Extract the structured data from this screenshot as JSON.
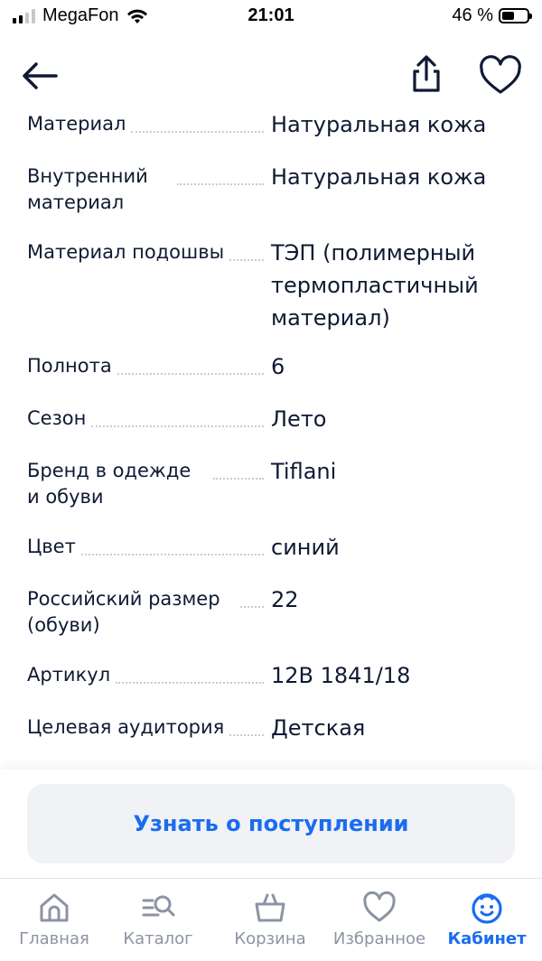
{
  "status_bar": {
    "carrier": "MegaFon",
    "time": "21:01",
    "battery": "46 %"
  },
  "nav": {
    "back_icon": "arrow-left-icon",
    "share_icon": "share-icon",
    "favorite_icon": "heart-icon"
  },
  "specs": [
    {
      "label": "Материал",
      "value": "Натуральная кожа"
    },
    {
      "label": "Внутренний материал",
      "value": "Натуральная кожа"
    },
    {
      "label": "Материал подошвы",
      "value": "ТЭП (полимерный термопластичный материал)"
    },
    {
      "label": "Полнота",
      "value": "6"
    },
    {
      "label": "Сезон",
      "value": "Лето"
    },
    {
      "label": "Бренд в одежде и обуви",
      "value": "Tiflani"
    },
    {
      "label": "Цвет",
      "value": "синий"
    },
    {
      "label": "Российский размер (обуви)",
      "value": "22"
    },
    {
      "label": "Артикул",
      "value": "12B 1841/18"
    },
    {
      "label": "Целевая аудитория",
      "value": "Детская"
    }
  ],
  "cta": {
    "label": "Узнать о поступлении"
  },
  "tabbar": {
    "items": [
      {
        "label": "Главная",
        "icon": "home-icon"
      },
      {
        "label": "Каталог",
        "icon": "catalog-search-icon"
      },
      {
        "label": "Корзина",
        "icon": "basket-icon"
      },
      {
        "label": "Избранное",
        "icon": "heart-icon"
      },
      {
        "label": "Кабинет",
        "icon": "profile-face-icon",
        "active": true
      }
    ]
  },
  "colors": {
    "accent": "#1a6cf0",
    "text": "#0f1a33",
    "muted": "#8c93a3",
    "cta_bg": "#f0f2f5"
  }
}
